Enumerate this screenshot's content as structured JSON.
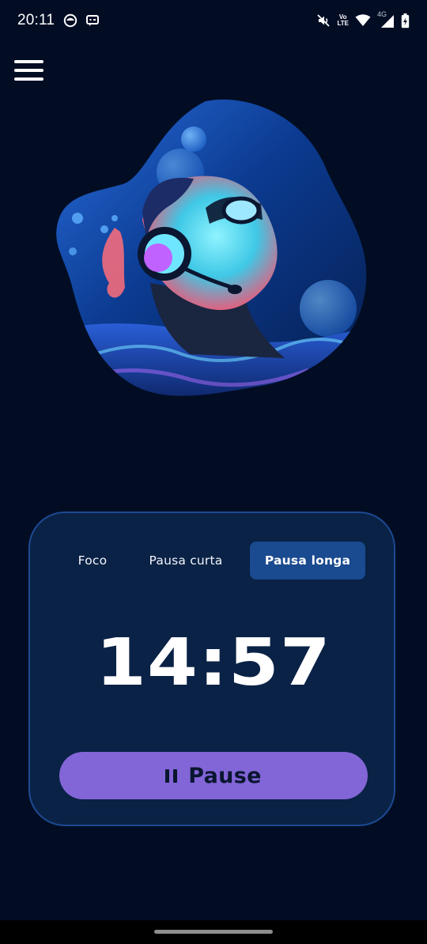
{
  "status_bar": {
    "time": "20:11",
    "left_icons": [
      "notification-icon",
      "message-icon"
    ],
    "right_icons": [
      "vibrate-mute-icon",
      "volte-icon",
      "wifi-icon",
      "cellular-signal-icon",
      "battery-icon"
    ],
    "volte_top": "Vo",
    "volte_bottom": "LTE",
    "network_type": "4G"
  },
  "menu": {
    "icon": "hamburger-menu-icon"
  },
  "hero": {
    "image": "diver-with-headphones-illustration"
  },
  "timer": {
    "tabs": [
      {
        "label": "Foco",
        "active": false
      },
      {
        "label": "Pausa curta",
        "active": false
      },
      {
        "label": "Pausa longa",
        "active": true
      }
    ],
    "time": "14:57",
    "action_label": "Pause",
    "action_icon": "pause-icon"
  },
  "colors": {
    "background": "#020d24",
    "card": "#0a2246",
    "card_border": "#1d4a93",
    "active_tab": "#1a4a8f",
    "accent_button": "#8265d7"
  }
}
